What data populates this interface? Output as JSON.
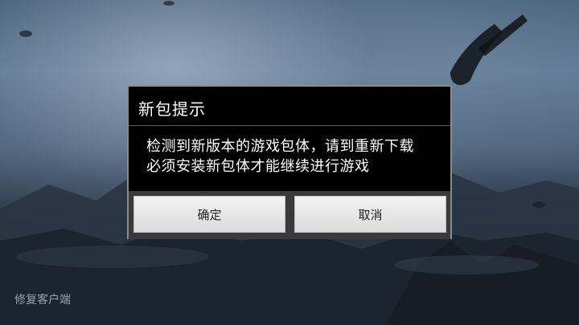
{
  "dialog": {
    "title": "新包提示",
    "message_lines": [
      "检测到新版本的游戏包体，请到重新下载",
      "必须安装新包体才能继续进行游戏"
    ],
    "confirm_label": "确定",
    "cancel_label": "取消"
  },
  "footer": {
    "repair_label": "修复客户端"
  },
  "colors": {
    "dialog_bg": "#000000",
    "dialog_border": "#8a8a8a",
    "button_bg": "#e6e6e6",
    "button_bar_bg": "#3a3a3a",
    "link_text": "#9aa3ac"
  }
}
